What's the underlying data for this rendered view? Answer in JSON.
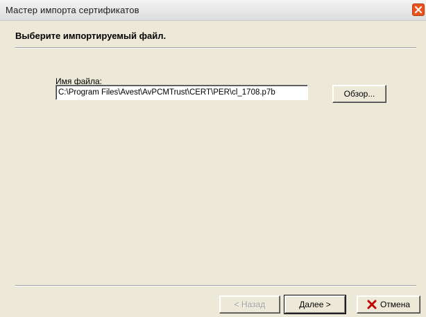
{
  "window": {
    "title": "Мастер импорта сертификатов",
    "close_icon": "close-icon"
  },
  "header": {
    "title": "Выберите импортируемый файл."
  },
  "file": {
    "label": "Имя файла:",
    "value": "C:\\Program Files\\Avest\\AvPCMTrust\\CERT\\PER\\cl_1708.p7b",
    "browse_label": "Обзор..."
  },
  "footer": {
    "back_label": "< Назад",
    "next_label": "Далее >",
    "cancel_label": "Отмена",
    "cancel_icon": "x-icon"
  },
  "colors": {
    "window_bg": "#ece9d8",
    "close_button": "#e8541d",
    "cancel_icon": "#c00000"
  }
}
